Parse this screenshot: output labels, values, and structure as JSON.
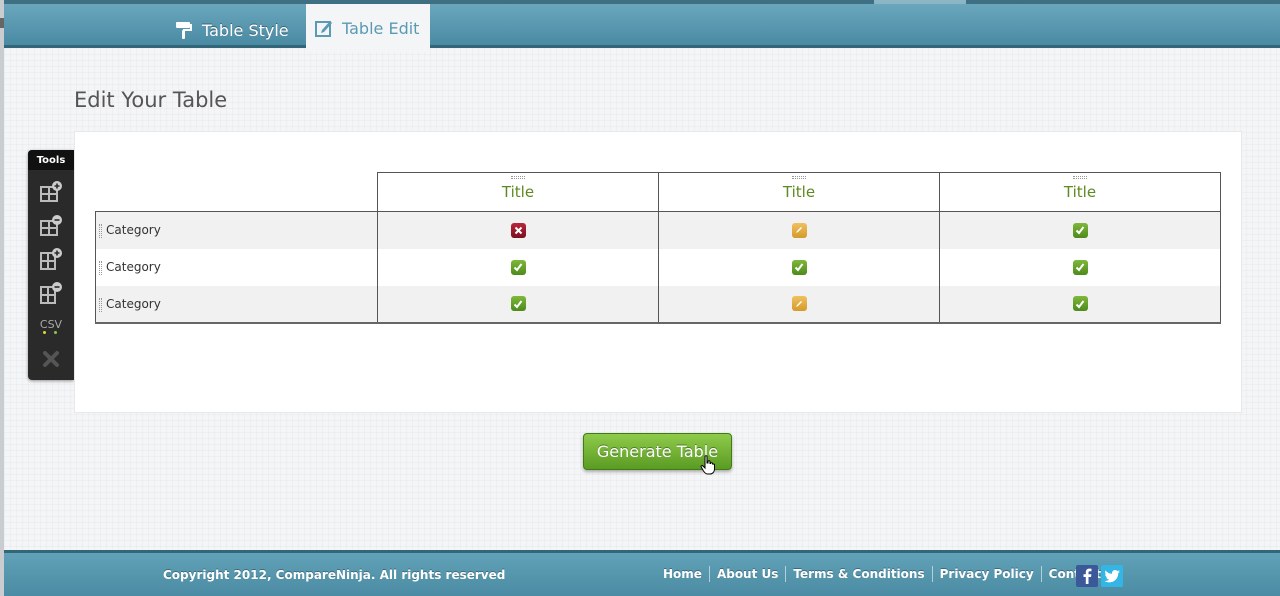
{
  "header": {
    "tabs": [
      {
        "label": "Table Style",
        "icon": "paint-roller-icon",
        "active": false
      },
      {
        "label": "Table Edit",
        "icon": "edit-icon",
        "active": true
      }
    ]
  },
  "main": {
    "title": "Edit Your Table",
    "tools": {
      "label": "Tools",
      "buttons": [
        {
          "name": "add-row",
          "icon": "add-row-icon"
        },
        {
          "name": "remove-row",
          "icon": "remove-row-icon"
        },
        {
          "name": "add-column",
          "icon": "add-column-icon"
        },
        {
          "name": "remove-column",
          "icon": "remove-column-icon"
        },
        {
          "name": "csv",
          "label": "CSV"
        },
        {
          "name": "clear",
          "icon": "close-icon"
        }
      ]
    },
    "table": {
      "columns": [
        "Title",
        "Title",
        "Title"
      ],
      "rows": [
        {
          "label": "Category",
          "cells": [
            "no",
            "partial",
            "yes"
          ]
        },
        {
          "label": "Category",
          "cells": [
            "yes",
            "yes",
            "yes"
          ]
        },
        {
          "label": "Category",
          "cells": [
            "yes",
            "partial",
            "yes"
          ]
        }
      ]
    },
    "generate_label": "Generate Table"
  },
  "footer": {
    "copyright": "Copyright 2012, CompareNinja. All rights reserved",
    "links": [
      "Home",
      "About Us",
      "Terms & Conditions",
      "Privacy Policy",
      "Contact Us"
    ],
    "social": [
      "facebook-icon",
      "twitter-icon"
    ]
  },
  "colors": {
    "header": "#5b9ab3",
    "accent_green": "#6aa82d",
    "title_green": "#5e8a1f",
    "no_red": "#9b1a2c",
    "partial_orange": "#e3ad45"
  }
}
